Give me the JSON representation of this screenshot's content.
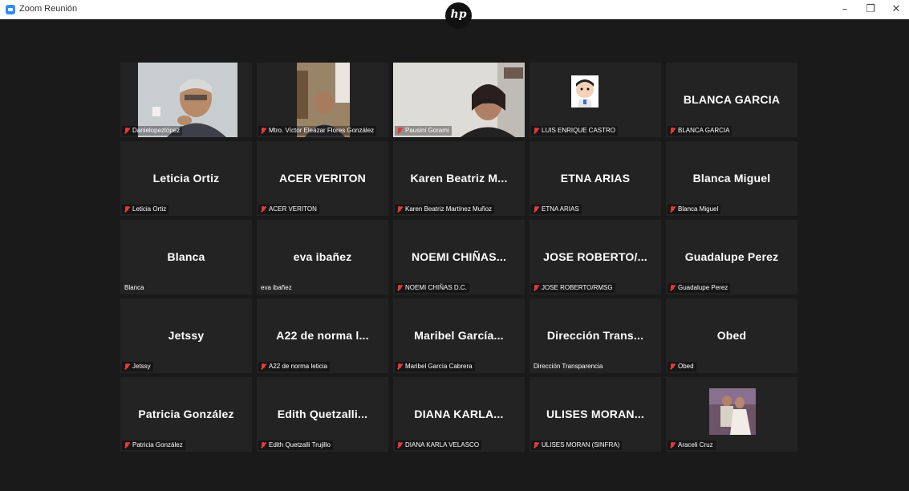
{
  "window": {
    "title": "Zoom Reunión",
    "minimize": "–",
    "maximize": "❐",
    "close": "✕"
  },
  "logo": {
    "text": "hp"
  },
  "participants": [
    {
      "big": "",
      "label": "Danielopezlópez",
      "muted": true,
      "video": "photo"
    },
    {
      "big": "",
      "label": "Mtro. Víctor Eleázar Flores González",
      "muted": true,
      "video": "photo"
    },
    {
      "big": "",
      "label": "Pausini Gorami",
      "muted": true,
      "video": "photo"
    },
    {
      "big": "",
      "label": "LUIS ENRIQUE CASTRO",
      "muted": true,
      "video": "avatar"
    },
    {
      "big": "BLANCA GARCIA",
      "label": "BLANCA GARCIA",
      "muted": true
    },
    {
      "big": "Leticia Ortiz",
      "label": "Leticia Ortiz",
      "muted": true
    },
    {
      "big": "ACER VERITON",
      "label": "ACER VERITON",
      "muted": true
    },
    {
      "big": "Karen Beatriz M...",
      "label": "Karen Beatriz Martínez Muñoz",
      "muted": true
    },
    {
      "big": "ETNA ARIAS",
      "label": "ETNA ARIAS",
      "muted": true
    },
    {
      "big": "Blanca Miguel",
      "label": "Blanca Miguel",
      "muted": true
    },
    {
      "big": "Blanca",
      "label": "Blanca",
      "muted": false
    },
    {
      "big": "eva ibañez",
      "label": "eva ibañez",
      "muted": false
    },
    {
      "big": "NOEMI CHIÑAS...",
      "label": "NOEMI CHIÑAS D.C.",
      "muted": true
    },
    {
      "big": "JOSE ROBERTO/...",
      "label": "JOSE ROBERTO/RMSG",
      "muted": true
    },
    {
      "big": "Guadalupe Perez",
      "label": "Guadalupe Perez",
      "muted": true
    },
    {
      "big": "Jetssy",
      "label": "Jetssy",
      "muted": true
    },
    {
      "big": "A22 de norma l...",
      "label": "A22 de norma leticia",
      "muted": true
    },
    {
      "big": "Maribel García...",
      "label": "Maribel García Cabrera",
      "muted": true
    },
    {
      "big": "Dirección Trans...",
      "label": "Dirección Transparencia",
      "muted": false
    },
    {
      "big": "Obed",
      "label": "Obed",
      "muted": true
    },
    {
      "big": "Patricia González",
      "label": "Patricia González",
      "muted": true
    },
    {
      "big": "Edith Quetzalli...",
      "label": "Edith Quetzalli Trujillo",
      "muted": true
    },
    {
      "big": "DIANA KARLA...",
      "label": "DIANA KARLA VELASCO",
      "muted": true
    },
    {
      "big": "ULISES MORAN...",
      "label": "ULISES MORAN (SINFRA)",
      "muted": true
    },
    {
      "big": "",
      "label": "Araceli Cruz",
      "muted": true,
      "video": "photo"
    }
  ]
}
